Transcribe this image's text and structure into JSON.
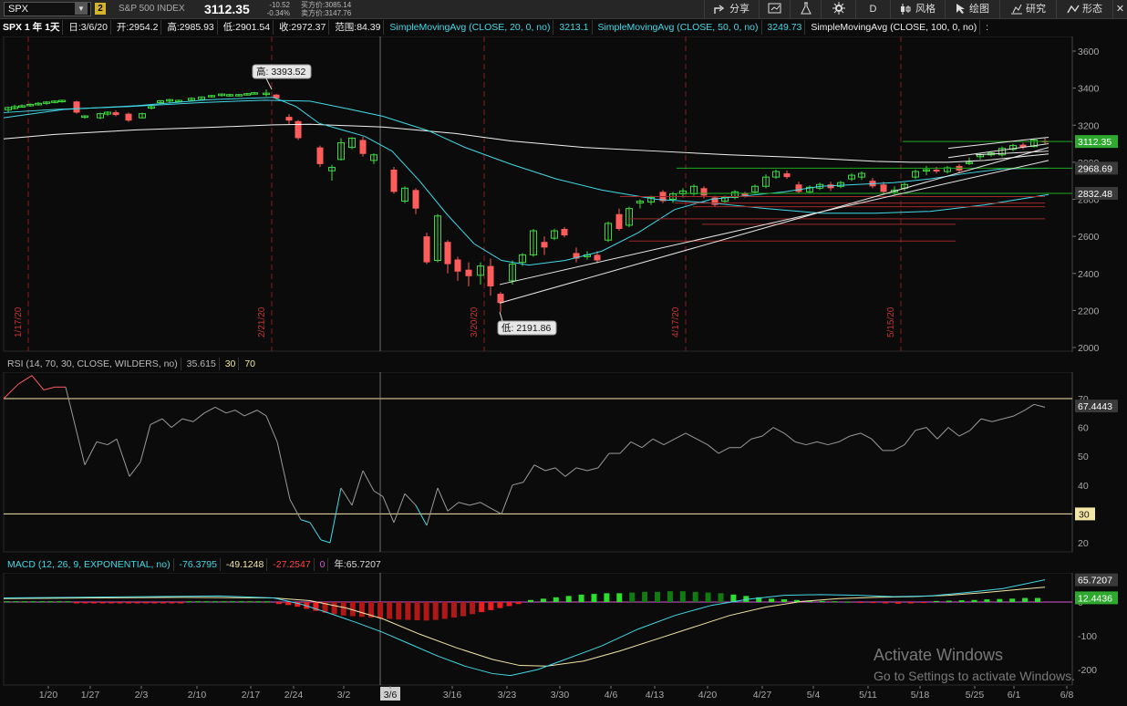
{
  "topbar": {
    "symbol": "SPX",
    "link_badge": "2",
    "index_name": "S&P 500 INDEX",
    "last_price": "3112.35",
    "net_change": "-10.52",
    "pct_change": "-0.34%",
    "bid_label": "买方价:3085.14",
    "ask_label": "卖方价:3147.76",
    "buttons": {
      "share": "分享",
      "period": "D",
      "style": "风格",
      "draw": "绘图",
      "study": "研究",
      "pattern": "形态"
    }
  },
  "header": {
    "chart_id": "SPX 1 年 1天",
    "date": "日:3/6/20",
    "open": "开:2954.2",
    "high": "高:2985.93",
    "low": "低:2901.54",
    "close": "收:2972.37",
    "range": "范围:84.39",
    "sma20_label": "SimpleMovingAvg (CLOSE, 20, 0, no)",
    "sma20_value": "3213.1",
    "sma50_label": "SimpleMovingAvg (CLOSE, 50, 0, no)",
    "sma50_value": "3249.73",
    "sma100_label": "SimpleMovingAvg (CLOSE, 100, 0, no)",
    "more": ":"
  },
  "price_panel": {
    "y_ticks": [
      "3600",
      "3400",
      "3200",
      "3000",
      "2800",
      "2600",
      "2400",
      "2200",
      "2000"
    ],
    "tag_price": "3112.35",
    "tag_sma20": "2968.69",
    "tag_sma50": "2832.48",
    "high_bubble": "高: 3393.52",
    "low_bubble": "低: 2191.86",
    "vline_dates": [
      "1/17/20",
      "2/21/20",
      "3/20/20",
      "4/17/20",
      "5/15/20"
    ],
    "colors": {
      "up": "#3ddc3d",
      "down": "#ff5c5c",
      "sma20": "#43d9e8",
      "sma50": "#43d9e8",
      "sma100": "#f2f2f2"
    }
  },
  "rsi_panel": {
    "label": "RSI (14, 70, 30, CLOSE, WILDERS, no)",
    "value": "35.615",
    "oversold": "30",
    "overbought": "70",
    "y_ticks": [
      "70",
      "60",
      "50",
      "40",
      "20"
    ],
    "tag_value": "67.4443",
    "tag_level": "30"
  },
  "macd_panel": {
    "label": "MACD (12, 26, 9, EXPONENTIAL, no)",
    "value": "-76.3795",
    "avg": "-49.1248",
    "diff": "-27.2547",
    "zero": "0",
    "extra": "年:65.7207",
    "y_ticks": [
      "0",
      "-100",
      "-200"
    ],
    "tag_value": "65.7207",
    "tag_avg": "12.4436"
  },
  "x_axis": {
    "labels": [
      "1/20",
      "1/27",
      "2/3",
      "2/10",
      "2/17",
      "2/24",
      "3/2",
      "3/6",
      "3/16",
      "3/23",
      "3/30",
      "4/6",
      "4/13",
      "4/20",
      "4/27",
      "5/4",
      "5/11",
      "5/18",
      "5/25",
      "6/1",
      "6/8"
    ]
  },
  "overlay": {
    "line1": "Activate Windows",
    "line2": "Go to Settings to activate Windows."
  }
}
